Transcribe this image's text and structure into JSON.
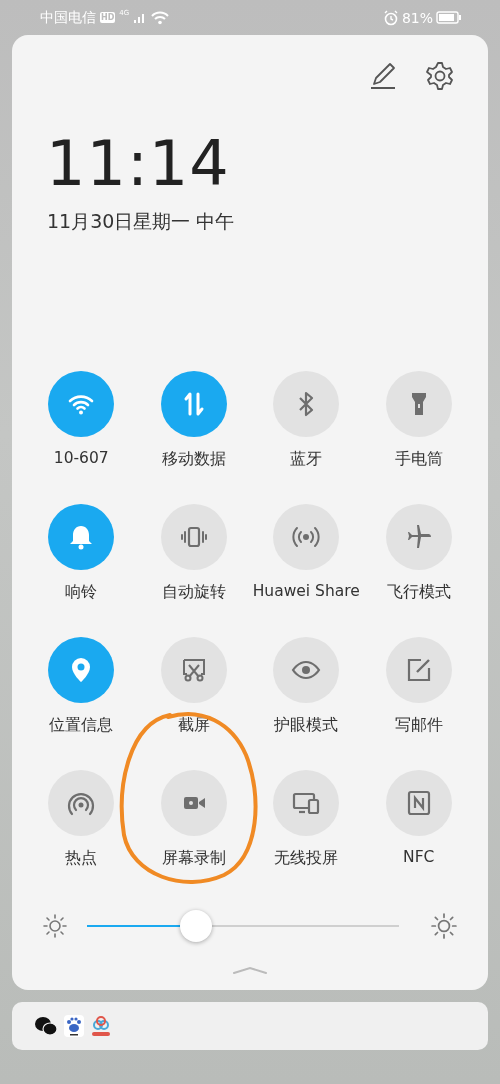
{
  "status_bar": {
    "carrier": "中国电信",
    "hd_badge": "HD",
    "network": "4G",
    "battery": "81%"
  },
  "clock": {
    "time": "11:14",
    "date": "11月30日星期一 中午"
  },
  "tiles": [
    {
      "label": "10-607",
      "on": true
    },
    {
      "label": "移动数据",
      "on": true
    },
    {
      "label": "蓝牙",
      "on": false
    },
    {
      "label": "手电筒",
      "on": false
    },
    {
      "label": "响铃",
      "on": true
    },
    {
      "label": "自动旋转",
      "on": false
    },
    {
      "label": "Huawei Share",
      "on": false
    },
    {
      "label": "飞行模式",
      "on": false
    },
    {
      "label": "位置信息",
      "on": true
    },
    {
      "label": "截屏",
      "on": false
    },
    {
      "label": "护眼模式",
      "on": false
    },
    {
      "label": "写邮件",
      "on": false
    },
    {
      "label": "热点",
      "on": false
    },
    {
      "label": "屏幕录制",
      "on": false
    },
    {
      "label": "无线投屏",
      "on": false
    },
    {
      "label": "NFC",
      "on": false
    }
  ],
  "brightness": {
    "level": 0.35
  }
}
